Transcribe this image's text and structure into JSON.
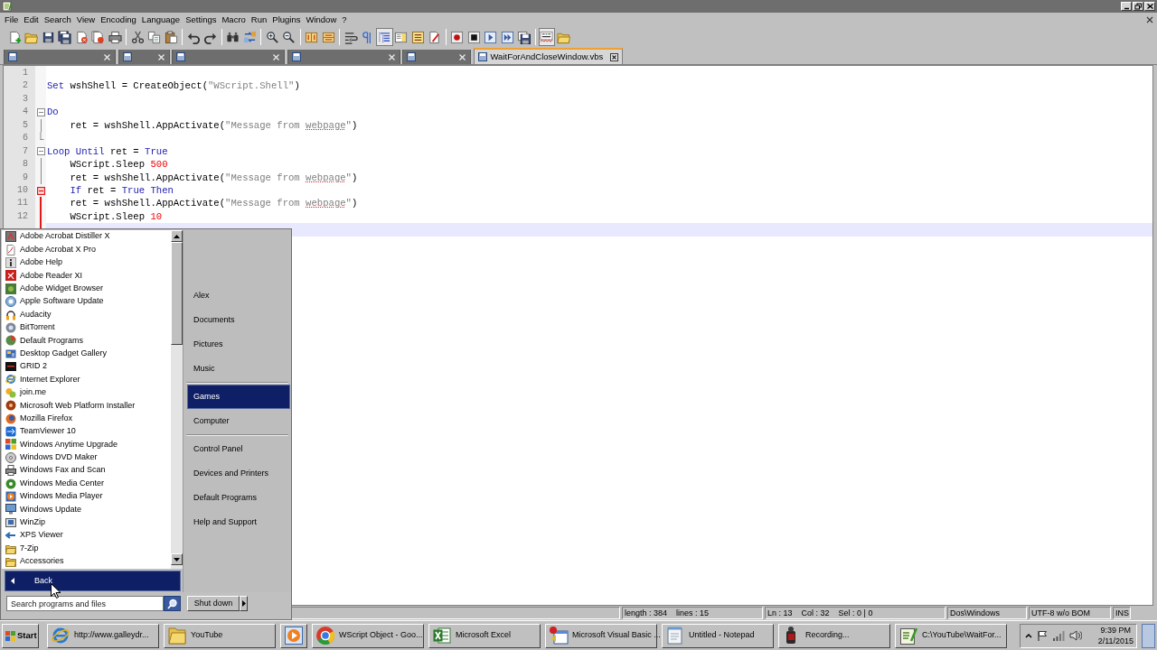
{
  "menu_bar": {
    "items": [
      "File",
      "Edit",
      "Search",
      "View",
      "Encoding",
      "Language",
      "Settings",
      "Macro",
      "Run",
      "Plugins",
      "Window",
      "?"
    ]
  },
  "toolbar": {
    "buttons": [
      {
        "pressed": false
      },
      {
        "pressed": false
      },
      {
        "pressed": false
      },
      {
        "pressed": false
      },
      {
        "pressed": false
      },
      {
        "pressed": false
      },
      {
        "pressed": false
      },
      {
        "pressed": false
      },
      {
        "pressed": false
      },
      {
        "pressed": false
      },
      {
        "pressed": false
      },
      {
        "pressed": false
      },
      {
        "pressed": false
      },
      {
        "pressed": false
      },
      {
        "pressed": false
      },
      {
        "pressed": false
      },
      {
        "pressed": false
      },
      {
        "pressed": false
      },
      {
        "pressed": false
      },
      {
        "pressed": false
      },
      {
        "pressed": true
      },
      {
        "pressed": false
      },
      {
        "pressed": false
      },
      {
        "pressed": false
      },
      {
        "pressed": false
      },
      {
        "pressed": false
      },
      {
        "pressed": false
      },
      {
        "pressed": false
      },
      {
        "pressed": false
      },
      {
        "pressed": true
      },
      {
        "pressed": false
      }
    ]
  },
  "tabs": [
    {
      "selected": false
    },
    {
      "selected": false
    },
    {
      "selected": false
    },
    {
      "selected": false
    },
    {
      "selected": false
    },
    {
      "label": "WaitForAndCloseWindow.vbs",
      "selected": true
    }
  ],
  "editor": {
    "lines": [
      {
        "number": "1",
        "kind": "plain",
        "current": false
      },
      {
        "number": "2",
        "kind": "plain",
        "tokens": [
          {
            "kind": "keyword",
            "text": "Set"
          },
          {
            "kind": "plain",
            "text": " wshShell = CreateObject("
          },
          {
            "kind": "string",
            "text": "\"WScript.Shell\""
          },
          {
            "kind": "plain",
            "text": ")"
          }
        ],
        "current": false
      },
      {
        "number": "3",
        "kind": "plain",
        "current": false
      },
      {
        "number": "4",
        "kind": "foldstart",
        "fold_active": false,
        "tokens": [
          {
            "kind": "keyword",
            "text": "Do"
          }
        ],
        "current": false
      },
      {
        "number": "5",
        "kind": "foldbody",
        "fold_active": false,
        "tokens": [
          {
            "kind": "plain",
            "text": "    ret = wshShell.AppActivate("
          },
          {
            "kind": "string",
            "text": "\"Message from "
          },
          {
            "kind": "misspelled",
            "text": "webpage"
          },
          {
            "kind": "string",
            "text": "\""
          },
          {
            "kind": "plain",
            "text": ")"
          }
        ],
        "current": false
      },
      {
        "number": "6",
        "kind": "foldend",
        "fold_active": false,
        "current": false
      },
      {
        "number": "7",
        "kind": "foldstart",
        "fold_active": false,
        "tokens": [
          {
            "kind": "keyword",
            "text": "Loop Until"
          },
          {
            "kind": "plain",
            "text": " ret = "
          },
          {
            "kind": "keyword",
            "text": "True"
          }
        ],
        "current": false
      },
      {
        "number": "8",
        "kind": "foldbody",
        "fold_active": false,
        "tokens": [
          {
            "kind": "plain",
            "text": "    WScript.Sleep "
          },
          {
            "kind": "number",
            "text": "500"
          }
        ],
        "current": false
      },
      {
        "number": "9",
        "kind": "foldbody",
        "fold_active": false,
        "tokens": [
          {
            "kind": "plain",
            "text": "    ret = wshShell.AppActivate("
          },
          {
            "kind": "string",
            "text": "\"Message from "
          },
          {
            "kind": "misspelled",
            "text": "webpage"
          },
          {
            "kind": "string",
            "text": "\""
          },
          {
            "kind": "plain",
            "text": ")"
          }
        ],
        "current": false
      },
      {
        "number": "10",
        "kind": "foldstart",
        "fold_active": true,
        "tokens": [
          {
            "kind": "keyword",
            "text": "    If"
          },
          {
            "kind": "plain",
            "text": " ret = "
          },
          {
            "kind": "keyword",
            "text": "True"
          },
          {
            "kind": "keyword",
            "text": " Then"
          }
        ],
        "current": false
      },
      {
        "number": "11",
        "kind": "foldbody",
        "fold_active": true,
        "tokens": [
          {
            "kind": "plain",
            "text": "    ret = wshShell.AppActivate("
          },
          {
            "kind": "string",
            "text": "\"Message from "
          },
          {
            "kind": "misspelled",
            "text": "webpage"
          },
          {
            "kind": "string",
            "text": "\""
          },
          {
            "kind": "plain",
            "text": ")"
          }
        ],
        "current": false
      },
      {
        "number": "12",
        "kind": "foldbody",
        "fold_active": true,
        "tokens": [
          {
            "kind": "plain",
            "text": "    WScript.Sleep "
          },
          {
            "kind": "number",
            "text": "10"
          }
        ],
        "current": false
      },
      {
        "kind": "foldbody",
        "fold_active": true,
        "current": true
      }
    ]
  },
  "status_bar": {
    "document_info": "length : 384    lines : 15",
    "position": "Ln : 13    Col : 32    Sel : 0 | 0",
    "line_endings": "Dos\\Windows",
    "encoding": "UTF-8 w/o BOM",
    "mode": "INS"
  },
  "start_menu": {
    "programs": [
      "Adobe Acrobat Distiller X",
      "Adobe Acrobat X Pro",
      "Adobe Help",
      "Adobe Reader XI",
      "Adobe Widget Browser",
      "Apple Software Update",
      "Audacity",
      "BitTorrent",
      "Default Programs",
      "Desktop Gadget Gallery",
      "GRID 2",
      "Internet Explorer",
      "join.me",
      "Microsoft Web Platform Installer",
      "Mozilla Firefox",
      "TeamViewer 10",
      "Windows Anytime Upgrade",
      "Windows DVD Maker",
      "Windows Fax and Scan",
      "Windows Media Center",
      "Windows Media Player",
      "Windows Update",
      "WinZip",
      "XPS Viewer",
      "7-Zip",
      "Accessories"
    ],
    "back": "Back",
    "places": [
      {
        "items": [
          {
            "label": "Alex",
            "selected": false
          },
          {
            "label": "Documents",
            "selected": false
          },
          {
            "label": "Pictures",
            "selected": false
          },
          {
            "label": "Music",
            "selected": false
          }
        ]
      },
      {
        "items": [
          {
            "label": "Games",
            "selected": true
          },
          {
            "label": "Computer",
            "selected": false
          }
        ]
      },
      {
        "items": [
          {
            "label": "Control Panel",
            "selected": false
          },
          {
            "label": "Devices and Printers",
            "selected": false
          },
          {
            "label": "Default Programs",
            "selected": false
          },
          {
            "label": "Help and Support",
            "selected": false
          }
        ]
      }
    ],
    "search": {
      "placeholder": "Search programs and files"
    },
    "shut_down": "Shut down"
  },
  "taskbar": {
    "start": "Start",
    "buttons": [
      {
        "kind": "window",
        "label": "http://www.galleydr..."
      },
      {
        "kind": "window",
        "label": "YouTube"
      },
      {
        "kind": "pinned"
      },
      {
        "kind": "window",
        "label": "WScript Object - Goo..."
      },
      {
        "kind": "window",
        "label": "Microsoft Excel"
      },
      {
        "kind": "window",
        "label": "Microsoft Visual Basic ..."
      },
      {
        "kind": "window",
        "label": "Untitled - Notepad"
      },
      {
        "kind": "window",
        "label": "Recording..."
      },
      {
        "kind": "window",
        "label": "C:\\YouTube\\WaitFor..."
      }
    ],
    "clock": {
      "time": "9:39 PM",
      "date": "2/11/2015"
    }
  }
}
